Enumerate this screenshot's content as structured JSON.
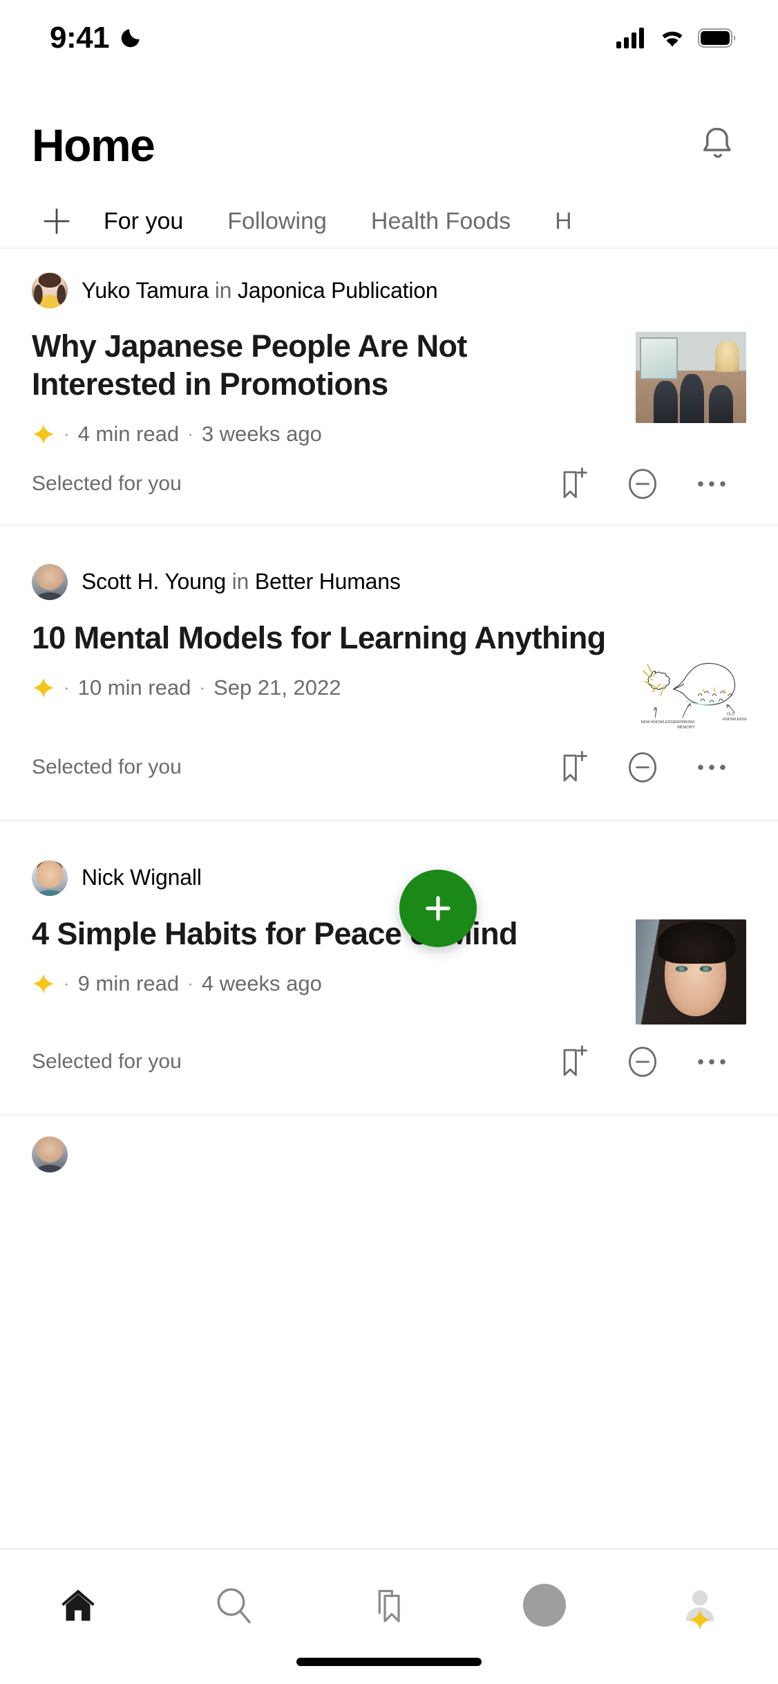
{
  "status_bar": {
    "time": "9:41",
    "moon_icon": "crescent-moon-icon",
    "signal_icon": "cellular-signal-icon",
    "wifi_icon": "wifi-icon",
    "battery_icon": "battery-full-icon"
  },
  "header": {
    "title": "Home",
    "notifications_icon": "bell-icon"
  },
  "tabs": {
    "add_icon": "plus-icon",
    "items": [
      {
        "label": "For you",
        "active": true
      },
      {
        "label": "Following",
        "active": false
      },
      {
        "label": "Health Foods",
        "active": false
      },
      {
        "label": "H",
        "active": false
      }
    ]
  },
  "feed": {
    "articles": [
      {
        "author": "Yuko Tamura",
        "in_word": "in",
        "publication": "Japonica Publication",
        "title": "Why Japanese People Are Not Interested in Promotions",
        "member_star": "yellow-star-icon",
        "read_time": "4  min read",
        "date": "3 weeks ago",
        "reason": "Selected for you",
        "separator": "·",
        "thumb_alt": "office-meeting-photo"
      },
      {
        "author": "Scott H. Young",
        "in_word": "in",
        "publication": "Better Humans",
        "title": "10 Mental Models for Learning Anything",
        "member_star": "yellow-star-icon",
        "read_time": "10  min read",
        "date": "Sep 21, 2022",
        "reason": "Selected for you",
        "separator": "·",
        "thumb_alt": "working-memory-sketch",
        "sketch_labels": [
          "NEW KNOWLEDGE",
          "WORKING MEMORY",
          "OLD KNOWLEDGE"
        ]
      },
      {
        "author": "Nick Wignall",
        "in_word": "",
        "publication": "",
        "title": "4 Simple Habits for Peace of Mind",
        "member_star": "yellow-star-icon",
        "read_time": "9  min read",
        "date": "4 weeks ago",
        "reason": "Selected for you",
        "separator": "·",
        "thumb_alt": "portrait-photo"
      }
    ],
    "card_actions": {
      "save_icon": "bookmark-plus-icon",
      "hide_icon": "minus-circle-icon",
      "more_icon": "ellipsis-icon"
    }
  },
  "fab": {
    "icon": "plus-icon",
    "color": "#1a8917",
    "label": "write-story"
  },
  "bottom_nav": {
    "items": [
      {
        "icon": "home-icon",
        "active": true
      },
      {
        "icon": "search-icon",
        "active": false
      },
      {
        "icon": "bookmarks-icon",
        "active": false
      },
      {
        "icon": "avatar-circle-icon",
        "active": false
      },
      {
        "icon": "profile-icon",
        "active": false,
        "badge": "yellow-star-icon"
      }
    ]
  },
  "colors": {
    "accent_green": "#1a8917",
    "star_yellow": "#f5c518",
    "text_primary": "#000000",
    "text_secondary": "#6b6b6b",
    "divider": "#f2f2f2"
  }
}
